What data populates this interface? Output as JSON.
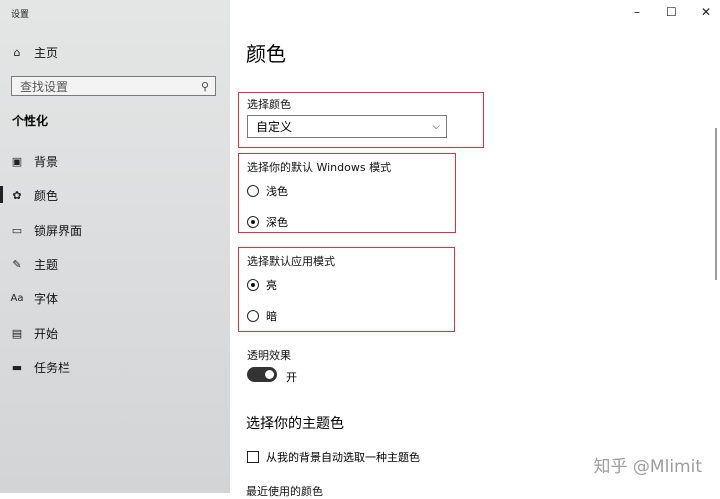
{
  "app": {
    "title": "设置"
  },
  "window": {
    "minimize": "–",
    "maximize": "☐",
    "close": "✕"
  },
  "sidebar": {
    "home": {
      "label": "主页",
      "icon": "home-icon"
    },
    "search": {
      "placeholder": "查找设置",
      "icon": "search-icon"
    },
    "section": "个性化",
    "items": [
      {
        "label": "背景",
        "icon": "image-icon"
      },
      {
        "label": "颜色",
        "icon": "palette-icon",
        "selected": true
      },
      {
        "label": "锁屏界面",
        "icon": "lock-screen-icon"
      },
      {
        "label": "主题",
        "icon": "theme-icon"
      },
      {
        "label": "字体",
        "icon": "font-icon"
      },
      {
        "label": "开始",
        "icon": "start-icon"
      },
      {
        "label": "任务栏",
        "icon": "taskbar-icon"
      }
    ]
  },
  "main": {
    "title": "颜色",
    "choose_color": {
      "label": "选择颜色",
      "value": "自定义"
    },
    "windows_mode": {
      "label": "选择你的默认 Windows 模式",
      "options": [
        "浅色",
        "深色"
      ],
      "selected": "深色"
    },
    "app_mode": {
      "label": "选择默认应用模式",
      "options": [
        "亮",
        "暗"
      ],
      "selected": "亮"
    },
    "transparency": {
      "label": "透明效果",
      "state": "开",
      "on": true
    },
    "accent": {
      "title": "选择你的主题色",
      "auto_label": "从我的背景自动选取一种主题色",
      "recent_label": "最近使用的颜色"
    }
  },
  "watermark": "知乎 @Mlimit",
  "colors": {
    "highlight_box": "#d9353a"
  }
}
